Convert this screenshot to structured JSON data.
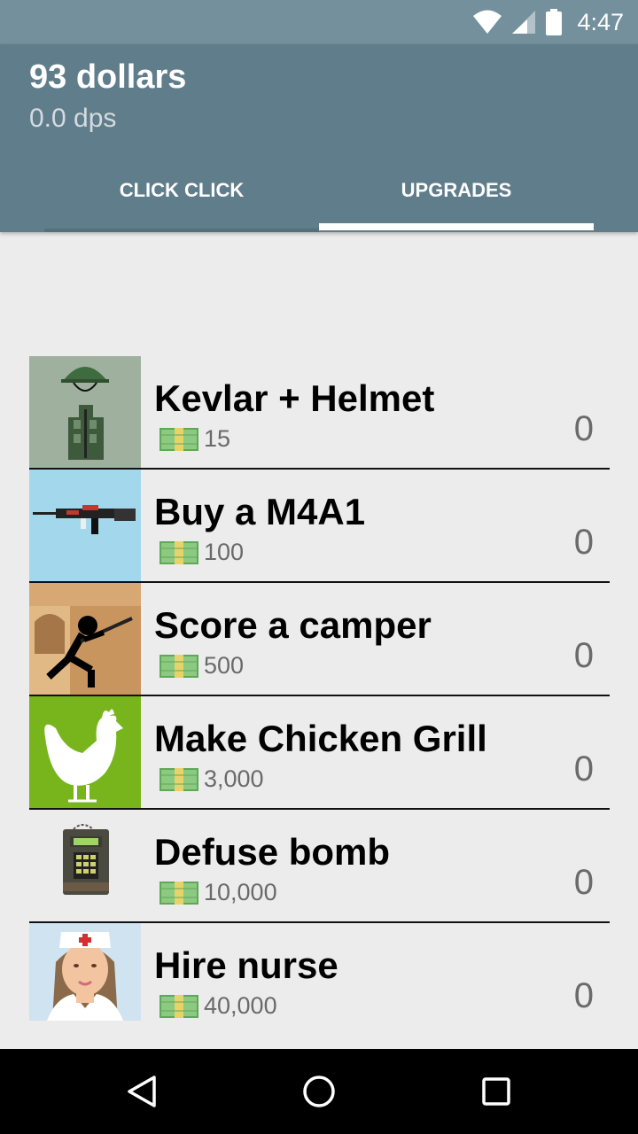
{
  "status_bar": {
    "time": "4:47"
  },
  "header": {
    "balance": "93 dollars",
    "dps": "0.0 dps"
  },
  "tabs": [
    {
      "label": "CLICK CLICK",
      "selected": false
    },
    {
      "label": "UPGRADES",
      "selected": true
    }
  ],
  "upgrades": [
    {
      "title": "Kevlar + Helmet",
      "price": "15",
      "owned": "0",
      "icon": "kevlar-helmet-icon"
    },
    {
      "title": "Buy a M4A1",
      "price": "100",
      "owned": "0",
      "icon": "m4a1-rifle-icon"
    },
    {
      "title": "Score a camper",
      "price": "500",
      "owned": "0",
      "icon": "sniper-camper-icon"
    },
    {
      "title": "Make Chicken Grill",
      "price": "3,000",
      "owned": "0",
      "icon": "chicken-icon"
    },
    {
      "title": "Defuse bomb",
      "price": "10,000",
      "owned": "0",
      "icon": "bomb-icon"
    },
    {
      "title": "Hire nurse",
      "price": "40,000",
      "owned": "0",
      "icon": "nurse-icon"
    }
  ],
  "colors": {
    "app_bar": "#607d8b",
    "status_bar": "#74909d",
    "background": "#ececec",
    "money_green": "#5fa858"
  }
}
